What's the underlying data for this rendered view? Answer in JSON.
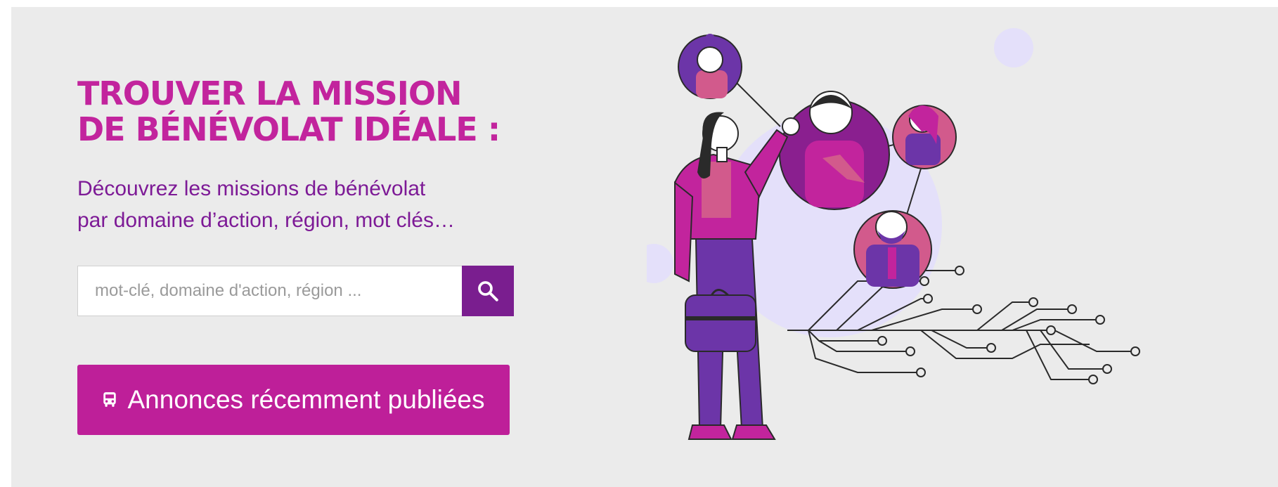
{
  "hero": {
    "title_line1": "TROUVER LA MISSION",
    "title_line2": "DE BÉNÉVOLAT IDÉALE :",
    "subtitle_line1": "Découvrez les missions de bénévolat",
    "subtitle_line2": "par domaine d’action, région, mot clés…"
  },
  "search": {
    "placeholder": "mot-clé, domaine d'action, région ...",
    "button_icon": "search-icon"
  },
  "cta": {
    "label": "Annonces récemment publiées",
    "icon": "bus-icon"
  },
  "colors": {
    "background": "#ebebeb",
    "title": "#c2249d",
    "subtitle": "#7d1a96",
    "search_button": "#7a1e8f",
    "cta_button": "#be1f99",
    "illustration_purple": "#6c35a8",
    "illustration_magenta": "#c2249d",
    "illustration_pink": "#d25a8c",
    "illustration_lavender": "#e4e0fa"
  }
}
